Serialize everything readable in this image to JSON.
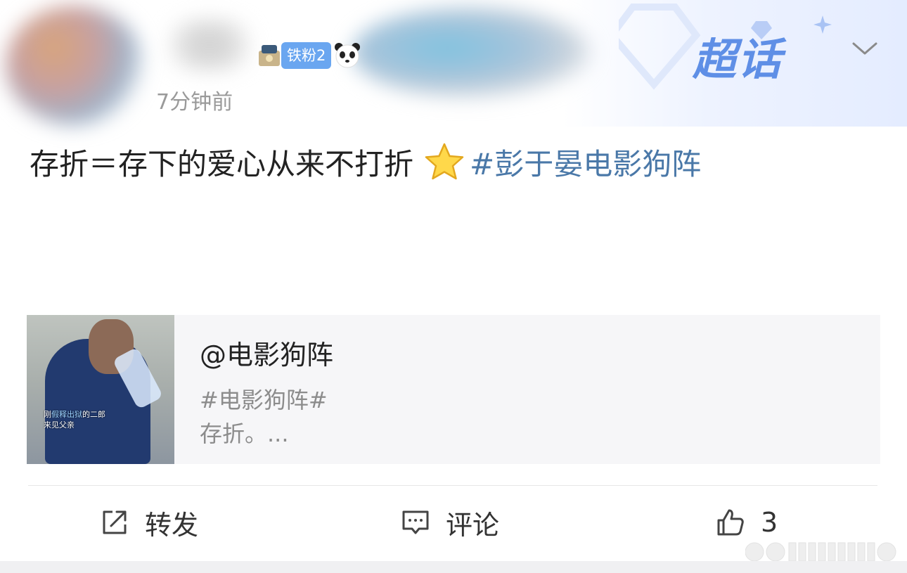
{
  "header": {
    "badge_label": "铁粉2",
    "time_text": "7分钟前",
    "brand_label": "超话",
    "dropdown_icon": "chevron-down-icon"
  },
  "post": {
    "text_prefix": "存折＝存下的爱心从来不打折",
    "emoji": "star",
    "hashtag": "#彭于晏电影狗阵"
  },
  "shared_card": {
    "title": "@电影狗阵",
    "line1": "#电影狗阵#",
    "line2": "存折。...",
    "thumb_caption_1a": "刚",
    "thumb_caption_1b": "假释出狱",
    "thumb_caption_1c": "的二郎",
    "thumb_caption_2": "来见父亲"
  },
  "actions": {
    "repost_label": "转发",
    "comment_label": "评论",
    "like_count": "3"
  },
  "colors": {
    "hashtag": "#4a78a8",
    "badge": "#6aa6f0",
    "brand": "#5f8fe6"
  }
}
